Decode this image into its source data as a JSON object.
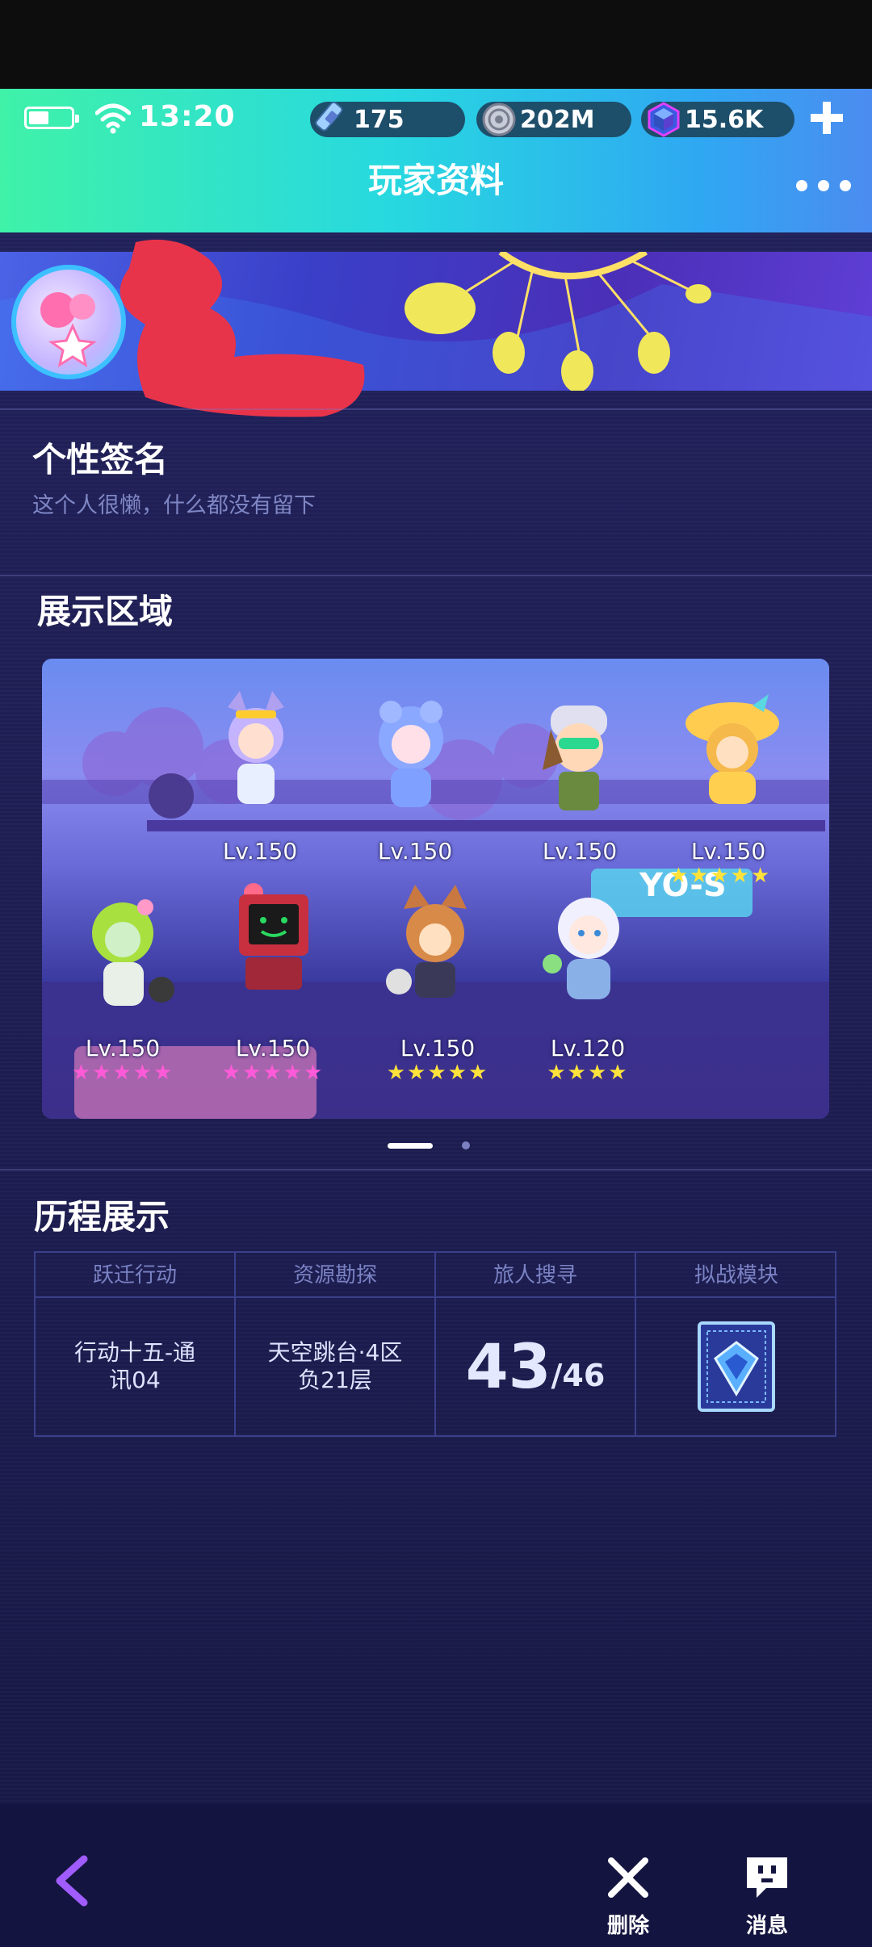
{
  "status": {
    "time": "13:20"
  },
  "currencies": [
    {
      "icon": "energy-ticket-icon",
      "value": "175"
    },
    {
      "icon": "coin-icon",
      "value": "202M"
    },
    {
      "icon": "gem-icon",
      "value": "15.6K"
    }
  ],
  "header": {
    "title": "玩家资料"
  },
  "signature": {
    "title": "个性签名",
    "text": "这个人很懒，什么都没有留下"
  },
  "showcase": {
    "title": "展示区域",
    "characters": [
      {
        "name": "character-fox-girl",
        "level": "Lv.150",
        "star_color": "none",
        "stars": ""
      },
      {
        "name": "character-blue-hair-girl",
        "level": "Lv.150",
        "star_color": "none",
        "stars": ""
      },
      {
        "name": "character-goggles-boy",
        "level": "Lv.150",
        "star_color": "none",
        "stars": ""
      },
      {
        "name": "character-straw-hat-girl",
        "level": "Lv.150",
        "star_color": "gold",
        "stars": "★★★★★"
      },
      {
        "name": "character-green-hair-girl",
        "level": "Lv.150",
        "star_color": "pink",
        "stars": "★★★★★"
      },
      {
        "name": "character-robot",
        "level": "Lv.150",
        "star_color": "pink",
        "stars": "★★★★★"
      },
      {
        "name": "character-fox-boy",
        "level": "Lv.150",
        "star_color": "gold",
        "stars": "★★★★★"
      },
      {
        "name": "character-white-hair-boy",
        "level": "Lv.120",
        "star_color": "gold",
        "stars": "★★★★"
      }
    ],
    "sign_text": "YO-S",
    "page_count": 2,
    "current_page": 1
  },
  "history": {
    "title": "历程展示",
    "columns": [
      {
        "header": "跃迁行动",
        "value_line1": "行动十五-通",
        "value_line2": "讯04"
      },
      {
        "header": "资源勘探",
        "value_line1": "天空跳台·4区",
        "value_line2": "负21层"
      },
      {
        "header": "旅人搜寻",
        "current": "43",
        "total": "/46"
      },
      {
        "header": "拟战模块",
        "badge": "combat-module-badge-icon"
      }
    ]
  },
  "bottom": {
    "delete_label": "删除",
    "message_label": "消息"
  },
  "colors": {
    "topbar_start": "#3ff2a8",
    "topbar_end": "#4b8cf0",
    "page_bg": "#1d1d52",
    "pink_star": "#ff5ad8",
    "gold_star": "#ffe33a",
    "back_arrow": "#a05cff"
  }
}
